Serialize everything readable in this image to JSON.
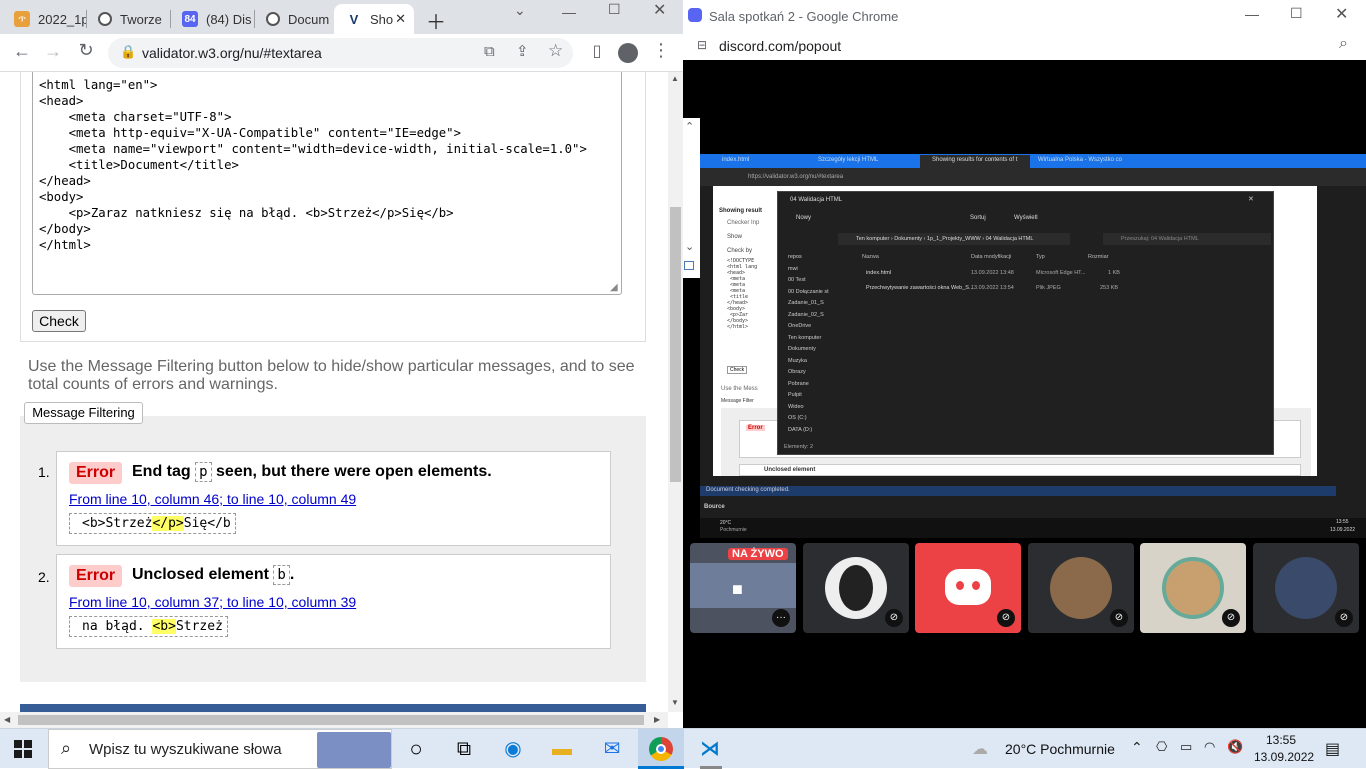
{
  "left_browser": {
    "tabs": [
      {
        "label": "2022_1p",
        "icon": "tab-favicon"
      },
      {
        "label": "Tworze",
        "icon": "globe-icon"
      },
      {
        "label": "(84) Dis",
        "icon": "discord-favicon"
      },
      {
        "label": "Docum",
        "icon": "globe-icon"
      },
      {
        "label": "Sho",
        "icon": "validator-favicon"
      }
    ],
    "url": "validator.w3.org/nu/#textarea",
    "textarea_lines": [
      "<html lang=\"en\">",
      "<head>",
      "    <meta charset=\"UTF-8\">",
      "    <meta http-equiv=\"X-UA-Compatible\" content=\"IE=edge\">",
      "    <meta name=\"viewport\" content=\"width=device-width, initial-scale=1.0\">",
      "    <title>Document</title>",
      "</head>",
      "<body>",
      "    <p>Zaraz natkniesz się na błąd. <b>Strzeż</p>Się</b>",
      "</body>",
      "</html>"
    ],
    "check_button": "Check",
    "filter_info": "Use the Message Filtering button below to hide/show particular messages, and to see total counts of errors and warnings.",
    "filter_button": "Message Filtering",
    "messages": [
      {
        "num": "1.",
        "badge": "Error",
        "title_pre": "End tag",
        "title_code": "p",
        "title_post": "seen, but there were open elements.",
        "location": "From line 10, column 46; to line 10, column 49",
        "extract_pre": "<b>Strzeż",
        "extract_hl": "</p>",
        "extract_post": "Się</b"
      },
      {
        "num": "2.",
        "badge": "Error",
        "title_pre": "Unclosed element",
        "title_code": "b",
        "title_post": ".",
        "location": "From line 10, column 37; to line 10, column 39",
        "extract_pre": "na błąd. ",
        "extract_hl": "<b>",
        "extract_post": "Strzeż"
      }
    ]
  },
  "right_window": {
    "title": "Sala spotkań 2 - Google Chrome",
    "url": "discord.com/popout",
    "live_label": "NA ŻYWO",
    "stream": {
      "tabs": [
        "index.html",
        "Szczegóły lekcji HTML",
        "Showing results for contents of t",
        "Wirtualna Polska - Wszystko co"
      ],
      "url": "https://validator.w3.org/nu/#textarea",
      "explorer_title": "04 Walidacja HTML",
      "breadcrumb": "Ten komputer › Dokumenty › 1p_1_Projekty_WWW › 04 Walidacja HTML",
      "search_placeholder": "Przeszukaj: 04 Walidacja HTML",
      "new_button": "Nowy",
      "sort_button": "Sortuj",
      "view_button": "Wyświetl",
      "columns": [
        "Nazwa",
        "Data modyfikacji",
        "Typ",
        "Rozmiar"
      ],
      "files": [
        {
          "name": "index.html",
          "date": "13.09.2022 13:48",
          "type": "Microsoft Edge HT...",
          "size": "1 KB"
        },
        {
          "name": "Przechwytywanie zawartości okna Web_S...",
          "date": "13.09.2022 13:54",
          "type": "Plik JPEG",
          "size": "253 KB"
        }
      ],
      "sidebar": [
        "repos",
        "mwi",
        "00 Test",
        "00 Dołączanie st",
        "Zadanie_01_S",
        "Zadanie_02_S",
        "OneDrive",
        "Ten komputer",
        "Dokumenty",
        "Muzyka",
        "Obrazy",
        "Pobrane",
        "Pulpit",
        "Wideo",
        "OS (C:)",
        "DATA (D:)"
      ],
      "status": "Elementy: 2",
      "doc_status": "Document checking completed.",
      "source_label": "Bource",
      "page_labels": [
        "Showing result",
        "Checker Inp",
        "Show",
        "Check by",
        "Check",
        "Use the Mess",
        "Message Filter",
        "Error",
        "Unclosed element"
      ],
      "weather": "20°C",
      "weather_desc": "Pochmurnie",
      "time": "13:55",
      "date": "13.09.2022"
    }
  },
  "taskbar": {
    "search_placeholder": "Wpisz tu wyszukiwane słowa",
    "weather": "20°C  Pochmurnie",
    "time": "13:55",
    "date": "13.09.2022"
  }
}
